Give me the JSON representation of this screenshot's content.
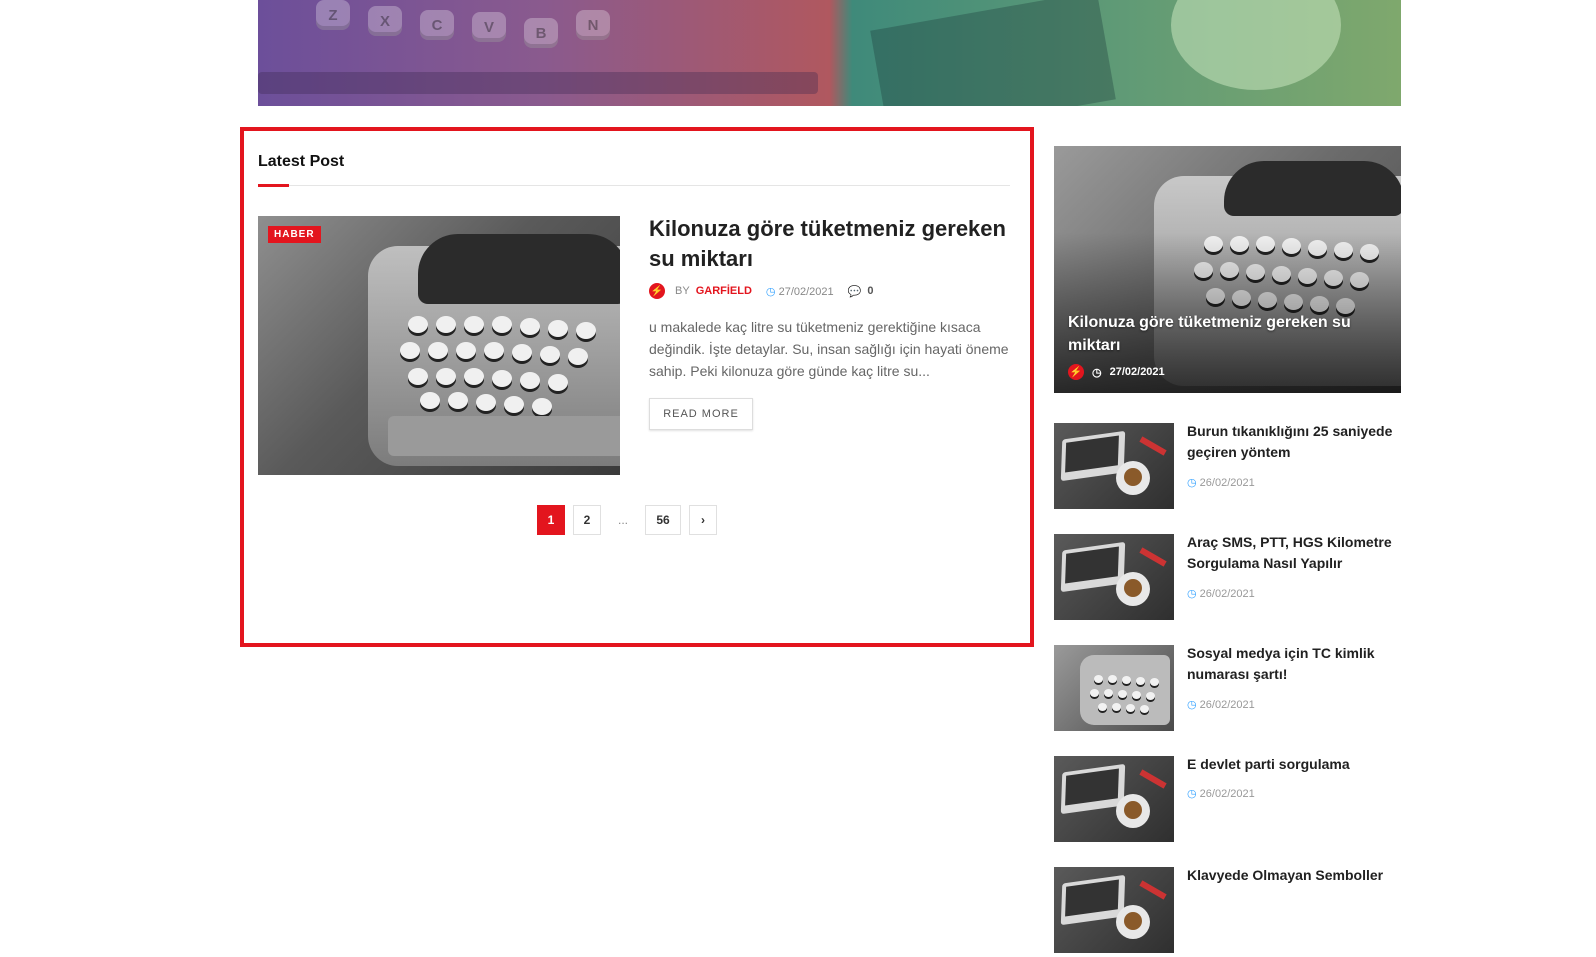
{
  "hero": {
    "keys": [
      "Z",
      "X",
      "C",
      "V",
      "B",
      "N"
    ]
  },
  "latest": {
    "section_title": "Latest Post",
    "post": {
      "category": "HABER",
      "title": "Kilonuza göre tüketmeniz gereken su miktarı",
      "by": "BY",
      "author": "GARFİELD",
      "date": "27/02/2021",
      "comments": "0",
      "excerpt": "u makalede kaç litre su tüketmeniz gerektiğine kısaca değindik. İşte detaylar. Su, insan sağlığı için hayati öneme sahip. Peki kilonuza göre günde kaç litre su...",
      "read_more": "READ MORE"
    },
    "pagination": {
      "pages": [
        "1",
        "2",
        "...",
        "56"
      ],
      "active": "1",
      "next": "›"
    }
  },
  "sidebar": {
    "featured": {
      "title": "Kilonuza göre tüketmeniz gereken su miktarı",
      "date": "27/02/2021"
    },
    "items": [
      {
        "title": "Burun tıkanıklığını 25 saniyede geçiren yöntem",
        "date": "26/02/2021",
        "thumb": "laptop"
      },
      {
        "title": "Araç SMS, PTT, HGS Kilometre Sorgulama Nasıl Yapılır",
        "date": "26/02/2021",
        "thumb": "laptop"
      },
      {
        "title": "Sosyal medya için TC kimlik numarası şartı!",
        "date": "26/02/2021",
        "thumb": "typewriter"
      },
      {
        "title": "E devlet parti sorgulama",
        "date": "26/02/2021",
        "thumb": "laptop"
      },
      {
        "title": "Klavyede Olmayan Semboller",
        "date": "",
        "thumb": "laptop"
      }
    ]
  },
  "colors": {
    "accent": "#e3151e",
    "meta_blue": "#2e9fff",
    "text": "#212121",
    "muted": "#666666"
  },
  "icons": {
    "avatar": "bolt-icon",
    "date": "clock-icon",
    "comments": "comment-icon",
    "next": "chevron-right-icon"
  }
}
